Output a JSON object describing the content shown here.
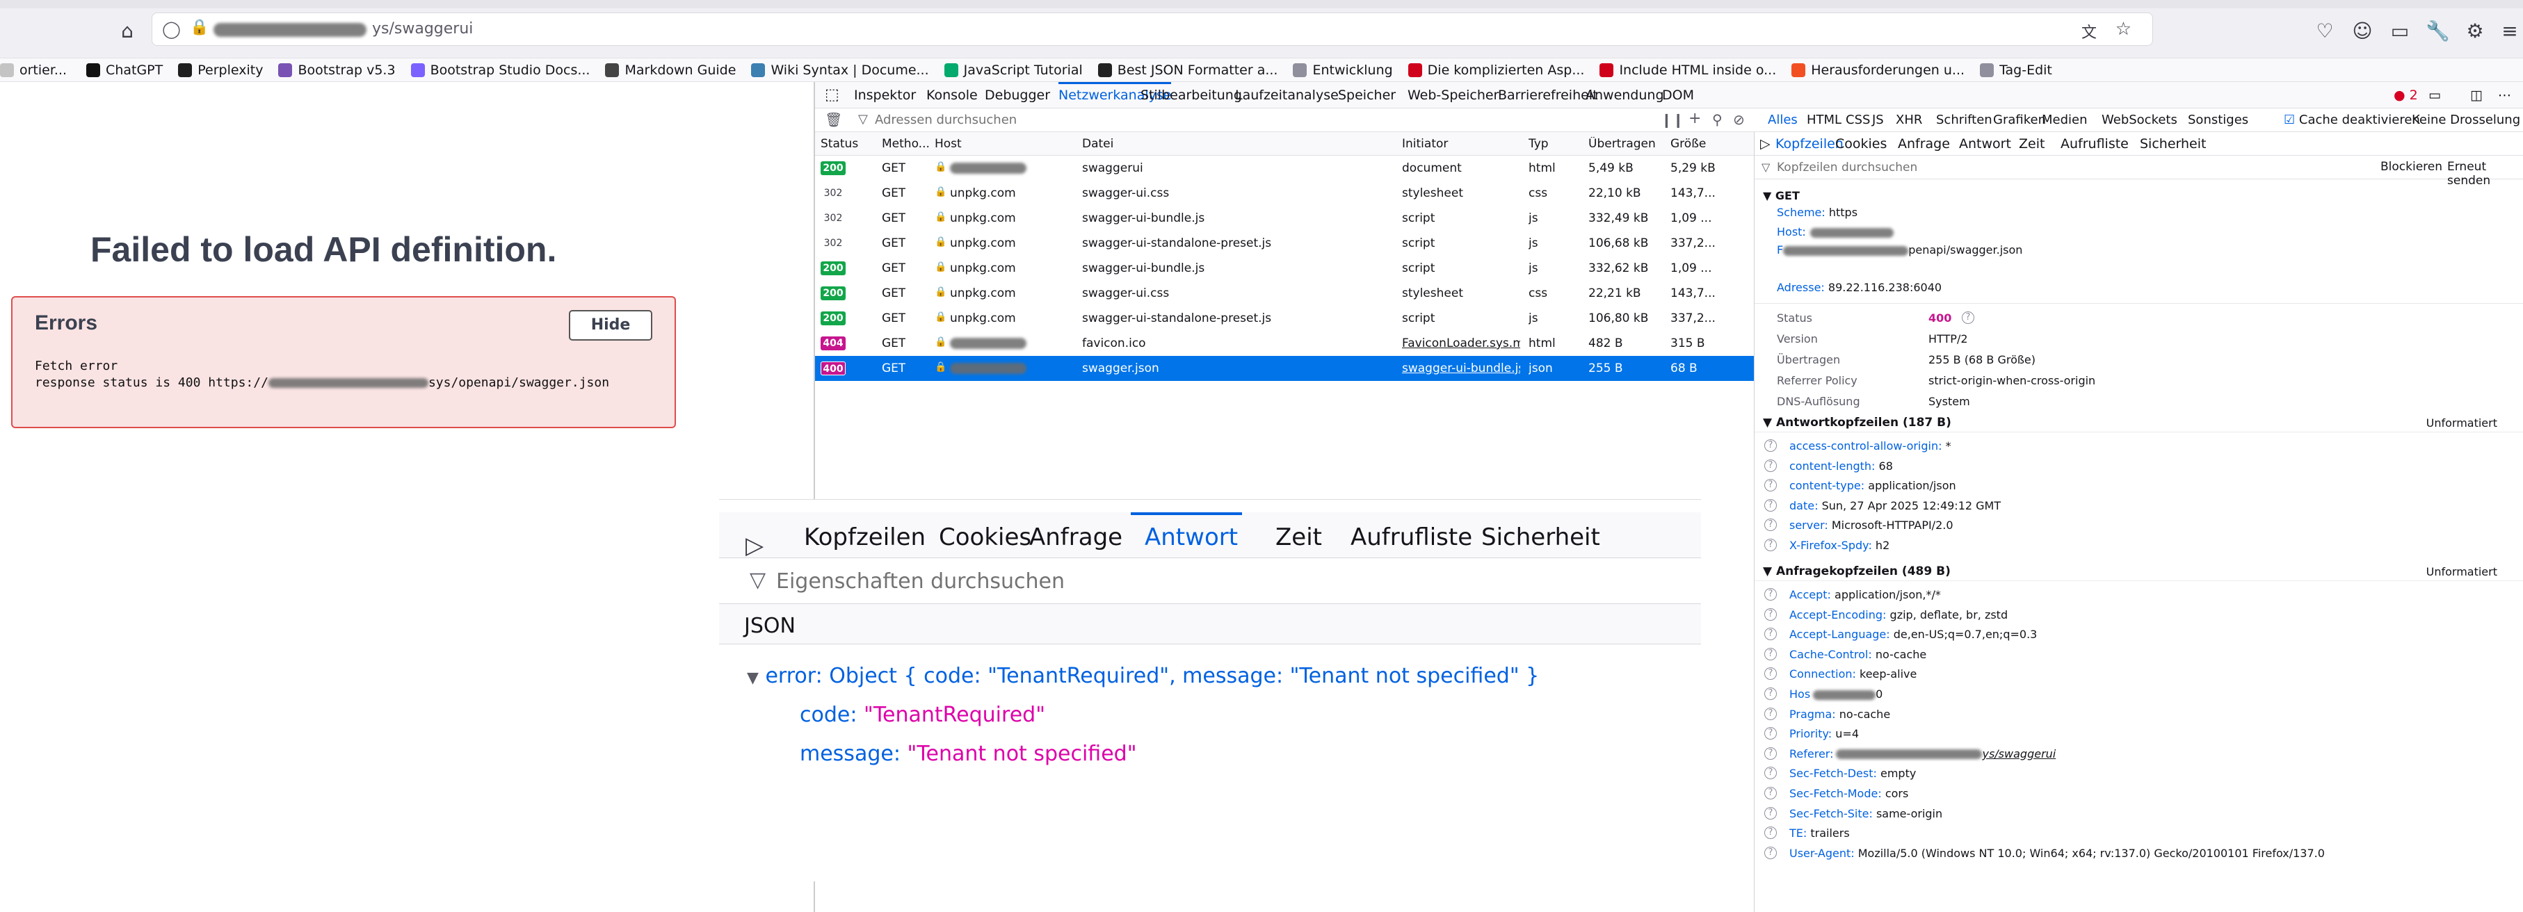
{
  "browser": {
    "url_suffix": "ys/swaggerui",
    "bookmarks": [
      {
        "label": "ortier...",
        "color": "#c4c4c4"
      },
      {
        "label": "ChatGPT",
        "color": "#111111"
      },
      {
        "label": "Perplexity",
        "color": "#1f1f1f"
      },
      {
        "label": "Bootstrap v5.3",
        "color": "#7952b3"
      },
      {
        "label": "Bootstrap Studio Docs...",
        "color": "#7b61ff"
      },
      {
        "label": "Markdown Guide",
        "color": "#444444"
      },
      {
        "label": "Wiki Syntax | Docume...",
        "color": "#3c7fb1"
      },
      {
        "label": "JavaScript Tutorial",
        "color": "#04aa6d"
      },
      {
        "label": "Best JSON Formatter a...",
        "color": "#222222"
      },
      {
        "label": "Entwicklung",
        "color": "#8f8f9d"
      },
      {
        "label": "Die komplizierten Asp...",
        "color": "#d0021b"
      },
      {
        "label": "Include HTML inside o...",
        "color": "#d0021b"
      },
      {
        "label": "Herausforderungen u...",
        "color": "#f25022"
      },
      {
        "label": "Tag-Edit",
        "color": "#8f8f9d"
      }
    ]
  },
  "swagger": {
    "title": "Failed to load API definition.",
    "errors_heading": "Errors",
    "hide_label": "Hide",
    "fetch_error": "Fetch error",
    "response_prefix": "response status is 400 https://",
    "response_suffix": "sys/openapi/swagger.json"
  },
  "devtools": {
    "tabs": [
      "Inspektor",
      "Konsole",
      "Debugger",
      "Netzwerkanalyse",
      "Stilbearbeitung",
      "Laufzeitanalyse",
      "Speicher",
      "Web-Speicher",
      "Barrierefreiheit",
      "Anwendung",
      "DOM"
    ],
    "selected_tab": "Netzwerkanalyse",
    "error_count": "2",
    "filter_placeholder": "Adressen durchsuchen",
    "type_filters": [
      "Alles",
      "HTML",
      "CSS",
      "JS",
      "XHR",
      "Schriften",
      "Grafiken",
      "Medien",
      "WebSockets",
      "Sonstiges"
    ],
    "cache_label": "Cache deaktivieren",
    "throttle_label": "Keine Drosselung ↕",
    "columns": [
      "Status",
      "Metho...",
      "Host",
      "Datei",
      "Initiator",
      "Typ",
      "Übertragen",
      "Größe"
    ],
    "requests": [
      {
        "status": "200",
        "method": "GET",
        "host": "",
        "file": "swaggerui",
        "initiator": "document",
        "type": "html",
        "transferred": "5,49 kB",
        "size": "5,29 kB"
      },
      {
        "status": "302",
        "method": "GET",
        "host": "unpkg.com",
        "file": "swagger-ui.css",
        "initiator": "stylesheet",
        "type": "css",
        "transferred": "22,10 kB",
        "size": "143,7..."
      },
      {
        "status": "302",
        "method": "GET",
        "host": "unpkg.com",
        "file": "swagger-ui-bundle.js",
        "initiator": "script",
        "type": "js",
        "transferred": "332,49 kB",
        "size": "1,09 ..."
      },
      {
        "status": "302",
        "method": "GET",
        "host": "unpkg.com",
        "file": "swagger-ui-standalone-preset.js",
        "initiator": "script",
        "type": "js",
        "transferred": "106,68 kB",
        "size": "337,2..."
      },
      {
        "status": "200",
        "method": "GET",
        "host": "unpkg.com",
        "file": "swagger-ui-bundle.js",
        "initiator": "script",
        "type": "js",
        "transferred": "332,62 kB",
        "size": "1,09 ..."
      },
      {
        "status": "200",
        "method": "GET",
        "host": "unpkg.com",
        "file": "swagger-ui.css",
        "initiator": "stylesheet",
        "type": "css",
        "transferred": "22,21 kB",
        "size": "143,7..."
      },
      {
        "status": "200",
        "method": "GET",
        "host": "unpkg.com",
        "file": "swagger-ui-standalone-preset.js",
        "initiator": "script",
        "type": "js",
        "transferred": "106,80 kB",
        "size": "337,2..."
      },
      {
        "status": "404",
        "method": "GET",
        "host": "",
        "file": "favicon.ico",
        "initiator": "FaviconLoader.sys.mj...",
        "type": "html",
        "transferred": "482 B",
        "size": "315 B"
      },
      {
        "status": "400",
        "method": "GET",
        "host": "",
        "file": "swagger.json",
        "initiator": "swagger-ui-bundle.js...",
        "type": "json",
        "transferred": "255 B",
        "size": "68 B"
      }
    ],
    "selected_request_index": 8
  },
  "headers_panel": {
    "tabs": [
      "Kopfzeilen",
      "Cookies",
      "Anfrage",
      "Antwort",
      "Zeit",
      "Aufrufliste",
      "Sicherheit"
    ],
    "selected_tab": "Kopfzeilen",
    "filter_placeholder": "Kopfzeilen durchsuchen",
    "block_label": "Blockieren",
    "resend_label": "Erneut senden",
    "method": "GET",
    "scheme_label": "Scheme:",
    "scheme_value": "https",
    "host_label": "Host:",
    "file_label": "F",
    "file_value": "penapi/swagger.json",
    "address_label": "Adresse:",
    "address_value": "89.22.116.238:6040",
    "status_rows": [
      {
        "label": "Status",
        "value": "400"
      },
      {
        "label": "Version",
        "value": "HTTP/2"
      },
      {
        "label": "Übertragen",
        "value": "255 B (68 B Größe)"
      },
      {
        "label": "Referrer Policy",
        "value": "strict-origin-when-cross-origin"
      },
      {
        "label": "DNS-Auflösung",
        "value": "System"
      }
    ],
    "response_section": "Antwortkopfzeilen (187 B)",
    "raw_label": "Unformatiert",
    "response_headers": [
      {
        "key": "access-control-allow-origin:",
        "value": "*"
      },
      {
        "key": "content-length:",
        "value": "68"
      },
      {
        "key": "content-type:",
        "value": "application/json"
      },
      {
        "key": "date:",
        "value": "Sun, 27 Apr 2025 12:49:12 GMT"
      },
      {
        "key": "server:",
        "value": "Microsoft-HTTPAPI/2.0"
      },
      {
        "key": "X-Firefox-Spdy:",
        "value": "h2"
      }
    ],
    "request_section": "Anfragekopfzeilen (489 B)",
    "request_headers": [
      {
        "key": "Accept:",
        "value": "application/json,*/*"
      },
      {
        "key": "Accept-Encoding:",
        "value": "gzip, deflate, br, zstd"
      },
      {
        "key": "Accept-Language:",
        "value": "de,en-US;q=0.7,en;q=0.3"
      },
      {
        "key": "Cache-Control:",
        "value": "no-cache"
      },
      {
        "key": "Connection:",
        "value": "keep-alive"
      },
      {
        "key": "Hos",
        "value": "0"
      },
      {
        "key": "Pragma:",
        "value": "no-cache"
      },
      {
        "key": "Priority:",
        "value": "u=4"
      },
      {
        "key": "Referer:",
        "value": "ys/swaggerui"
      },
      {
        "key": "Sec-Fetch-Dest:",
        "value": "empty"
      },
      {
        "key": "Sec-Fetch-Mode:",
        "value": "cors"
      },
      {
        "key": "Sec-Fetch-Site:",
        "value": "same-origin"
      },
      {
        "key": "TE:",
        "value": "trailers"
      },
      {
        "key": "User-Agent:",
        "value": "Mozilla/5.0 (Windows NT 10.0; Win64; x64; rv:137.0) Gecko/20100101 Firefox/137.0"
      }
    ]
  },
  "zoom_panel": {
    "tabs": [
      "Kopfzeilen",
      "Cookies",
      "Anfrage",
      "Antwort",
      "Zeit",
      "Aufrufliste",
      "Sicherheit"
    ],
    "selected_tab": "Antwort",
    "filter_placeholder": "Eigenschaften durchsuchen",
    "json_label": "JSON",
    "summary_key": "error:",
    "summary_value": "Object { code: \"TenantRequired\", message: \"Tenant not specified\" }",
    "code_key": "code:",
    "code_value": "\"TenantRequired\"",
    "message_key": "message:",
    "message_value": "\"Tenant not specified\""
  }
}
